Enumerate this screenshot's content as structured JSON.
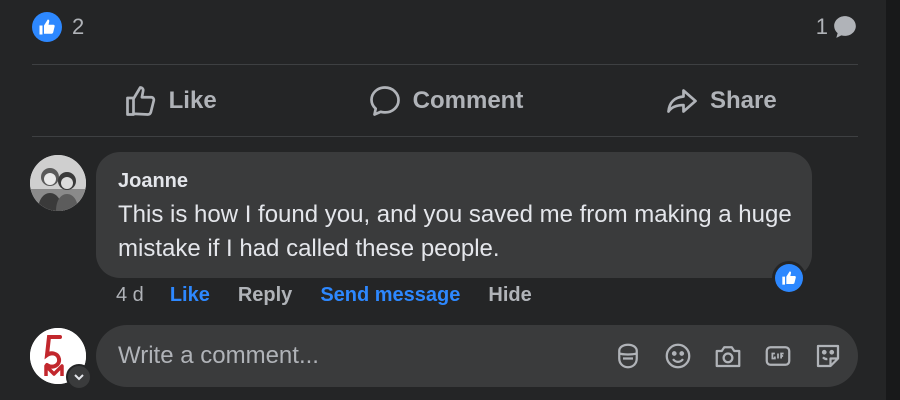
{
  "reactions": {
    "count": "2",
    "comment_count": "1"
  },
  "actions": {
    "like": "Like",
    "comment": "Comment",
    "share": "Share"
  },
  "comment": {
    "author": "Joanne",
    "text": "This is how I found you, and you saved me from making a huge mistake if I had called these people.",
    "time": "4 d",
    "like": "Like",
    "reply": "Reply",
    "send_message": "Send message",
    "hide": "Hide"
  },
  "composer": {
    "placeholder": "Write a comment..."
  },
  "colors": {
    "background": "#242526",
    "bubble": "#3a3b3c",
    "accent": "#2d88ff",
    "muted": "#b0b3b8"
  }
}
